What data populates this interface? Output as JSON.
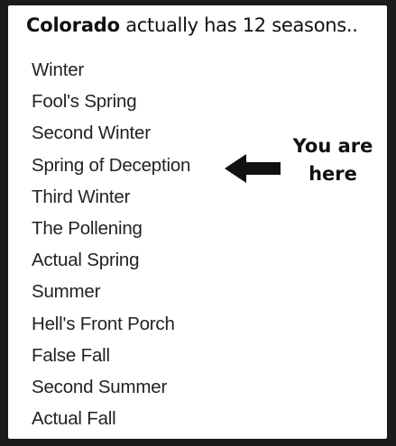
{
  "post": {
    "title_place": "Colorado",
    "title_rest": " actually has 12 seasons..",
    "seasons": [
      "Winter",
      "Fool's Spring",
      "Second Winter",
      "Spring of Deception",
      "Third Winter",
      "The Pollening",
      "Actual Spring",
      "Summer",
      "Hell's Front Porch",
      "False Fall",
      "Second Summer",
      "Actual Fall"
    ],
    "marker": {
      "line1": "You are",
      "line2": "here",
      "points_to": "Spring of Deception",
      "icon": "left-arrow-icon"
    }
  }
}
